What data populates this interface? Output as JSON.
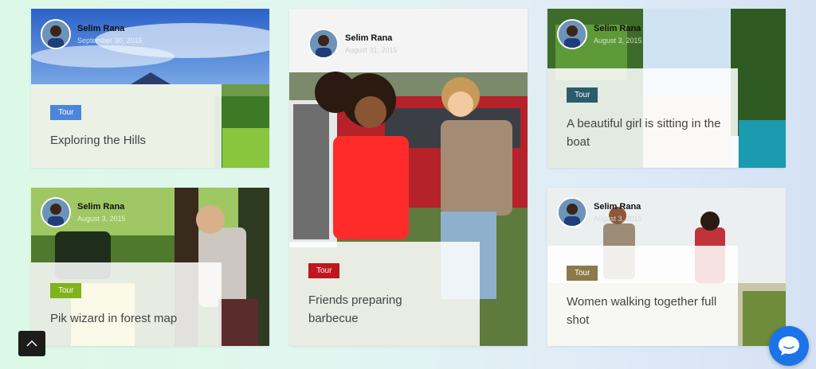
{
  "cards": [
    {
      "author": "Selim Rana",
      "date": "September 30, 2015",
      "tag": "Tour",
      "tag_color": "#4a86d9",
      "title": "Exploring the Hills"
    },
    {
      "author": "Selim Rana",
      "date": "August 31, 2015",
      "tag": "Tour",
      "tag_color": "#c0161d",
      "title": "Friends preparing barbecue"
    },
    {
      "author": "Selim Rana",
      "date": "August 3, 2015",
      "tag": "Tour",
      "tag_color": "#2a5d6b",
      "title": "A beautiful girl is sitting in the boat"
    },
    {
      "author": "Selim Rana",
      "date": "August 3, 2015",
      "tag": "Tour",
      "tag_color": "#7fb21b",
      "title": "Pik wizard in forest map"
    },
    {
      "author": "Selim Rana",
      "date": "August 3, 2015",
      "tag": "Tour",
      "tag_color": "#8b7a4a",
      "title": "Women walking together full shot"
    }
  ],
  "icons": {
    "back_to_top": "chevron-up-icon",
    "chat": "chat-bubble-icon"
  }
}
